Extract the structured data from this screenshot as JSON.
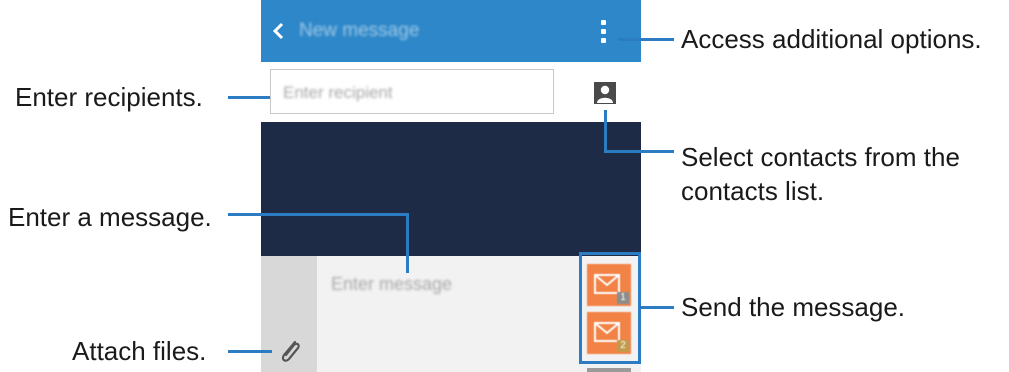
{
  "screen": {
    "title": "New message",
    "recipient_placeholder": "Enter recipient",
    "message_placeholder": "Enter message",
    "sim_1": "1",
    "sim_2": "2"
  },
  "callouts": {
    "access_options": "Access additional options.",
    "enter_recipients": "Enter recipients.",
    "select_contacts_line1": "Select contacts from the",
    "select_contacts_line2": "contacts list.",
    "enter_message": "Enter a message.",
    "send_message": "Send the message.",
    "attach_files": "Attach files."
  },
  "colors": {
    "action_bar": "#2d87c8",
    "send_button": "#f28246",
    "callout_line": "#2b7cc2",
    "conversation_bg": "#1d2b47"
  },
  "icons": [
    "back-icon",
    "more-options-icon",
    "contact-icon",
    "attach-icon",
    "send-icon"
  ]
}
